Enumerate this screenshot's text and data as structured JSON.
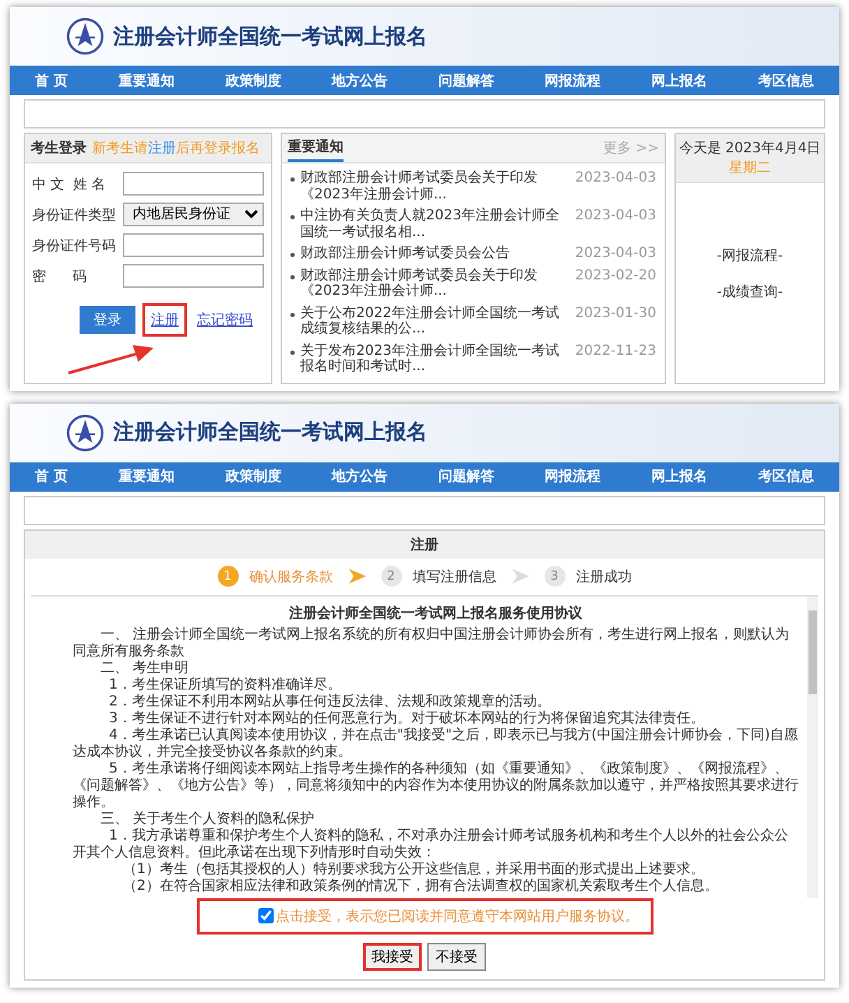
{
  "login_page": {
    "site_title": "注册会计师全国统一考试网上报名",
    "nav": [
      {
        "label": "首 页"
      },
      {
        "label": "重要通知"
      },
      {
        "label": "政策制度"
      },
      {
        "label": "地方公告"
      },
      {
        "label": "问题解答"
      },
      {
        "label": "网报流程"
      },
      {
        "label": "网上报名"
      },
      {
        "label": "考区信息"
      }
    ],
    "login": {
      "title": "考生登录",
      "hint_before": "新考生请",
      "hint_link": "注册",
      "hint_after": "后再登录报名",
      "fields": [
        {
          "kind": "text",
          "label": "中 文  姓 名"
        },
        {
          "kind": "select",
          "label": "身份证件类型",
          "value": "内地居民身份证"
        },
        {
          "kind": "text",
          "label": "身份证件号码"
        },
        {
          "kind": "password",
          "label": "密      码"
        }
      ],
      "login_button": "登录",
      "register_link": {
        "label": "注册",
        "highlighted": true
      },
      "forgot_link": "忘记密码"
    },
    "notices": {
      "title": "重要通知",
      "more": "更多 >>",
      "items": [
        {
          "title": "财政部注册会计师考试委员会关于印发《2023年注册会计师...",
          "date": "2023-04-03"
        },
        {
          "title": "中注协有关负责人就2023年注册会计师全国统一考试报名相...",
          "date": "2023-04-03"
        },
        {
          "title": "财政部注册会计师考试委员会公告",
          "date": "2023-04-03"
        },
        {
          "title": "财政部注册会计师考试委员会关于印发《2023年注册会计师...",
          "date": "2023-02-20"
        },
        {
          "title": "关于公布2022年注册会计师全国统一考试成绩复核结果的公...",
          "date": "2023-01-30"
        },
        {
          "title": "关于发布2023年注册会计师全国统一考试报名时间和考试时...",
          "date": "2022-11-23"
        }
      ]
    },
    "calendar": {
      "today": "今天是 2023年4月4日",
      "weekday": "星期二",
      "links": [
        "-网报流程-",
        "-成绩查询-"
      ]
    },
    "annotation_arrow": true
  },
  "register_page": {
    "site_title": "注册会计师全国统一考试网上报名",
    "nav": [
      {
        "label": "首 页"
      },
      {
        "label": "重要通知"
      },
      {
        "label": "政策制度"
      },
      {
        "label": "地方公告"
      },
      {
        "label": "问题解答"
      },
      {
        "label": "网报流程"
      },
      {
        "label": "网上报名"
      },
      {
        "label": "考区信息"
      }
    ],
    "panel_title": "注册",
    "steps": [
      {
        "number": "1",
        "label": "确认服务条款",
        "selected": true
      },
      {
        "number": "2",
        "label": "填写注册信息",
        "selected": false
      },
      {
        "number": "3",
        "label": "注册成功",
        "selected": false
      }
    ],
    "agreement": {
      "title": "注册会计师全国统一考试网上报名服务使用协议",
      "paragraphs": [
        {
          "kind": "section",
          "text": "一、 注册会计师全国统一考试网上报名系统的所有权归中国注册会计师协会所有，考生进行网上报名，则默认为同意所有服务条款"
        },
        {
          "kind": "section",
          "text": "二、 考生申明"
        },
        {
          "kind": "item",
          "text": "1．考生保证所填写的资料准确详尽。"
        },
        {
          "kind": "item",
          "text": "2．考生保证不利用本网站从事任何违反法律、法规和政策规章的活动。"
        },
        {
          "kind": "item",
          "text": "3．考生保证不进行针对本网站的任何恶意行为。对于破坏本网站的行为将保留追究其法律责任。"
        },
        {
          "kind": "item",
          "text": "4．考生承诺已认真阅读本使用协议，并在点击\"我接受\"之后，即表示已与我方(中国注册会计师协会，下同)自愿达成本协议，并完全接受协议各条款的约束。"
        },
        {
          "kind": "item",
          "text": "5．考生承诺将仔细阅读本网站上指导考生操作的各种须知（如《重要通知》、《政策制度》、《网报流程》、《问题解答》、《地方公告》等），同意将须知中的内容作为本使用协议的附属条款加以遵守，并严格按照其要求进行操作。"
        },
        {
          "kind": "section",
          "text": "三、 关于考生个人资料的隐私保护"
        },
        {
          "kind": "item",
          "text": "1．我方承诺尊重和保护考生个人资料的隐私，不对承办注册会计师考试服务机构和考生个人以外的社会公众公开其个人信息资料。但此承诺在出现下列情形时自动失效："
        },
        {
          "kind": "sub",
          "text": "（1）考生（包括其授权的人）特别要求我方公开这些信息，并采用书面的形式提出上述要求。"
        },
        {
          "kind": "sub",
          "text": "（2）在符合国家相应法律和政策条例的情况下，拥有合法调查权的国家机关索取考生个人信息。"
        }
      ]
    },
    "consent": {
      "checked": true,
      "text": "点击接受，表示您已阅读并同意遵守本网站用户服务协议。",
      "highlighted": true
    },
    "buttons": [
      {
        "label": "我接受",
        "highlighted": true
      },
      {
        "label": "不接受",
        "highlighted": false
      }
    ]
  }
}
